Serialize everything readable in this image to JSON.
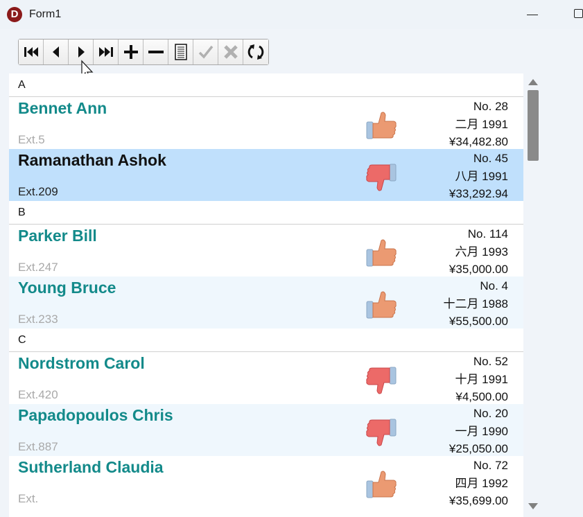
{
  "window": {
    "title": "Form1",
    "icon_letter": "D"
  },
  "navigator": {
    "buttons": [
      "first-icon",
      "prior-icon",
      "next-icon",
      "last-icon",
      "insert-icon",
      "delete-icon",
      "edit-icon",
      "post-icon",
      "cancel-icon",
      "refresh-icon"
    ]
  },
  "list": {
    "groups": [
      {
        "header": "A",
        "items": [
          {
            "name": "Bennet Ann",
            "ext": "Ext.5",
            "number": "No. 28",
            "date": "二月 1991",
            "amount": "¥34,482.80",
            "rating": "thumbs-up"
          },
          {
            "name": "Ramanathan Ashok",
            "ext": "Ext.209",
            "number": "No. 45",
            "date": "八月 1991",
            "amount": "¥33,292.94",
            "rating": "thumbs-down",
            "selected": true
          }
        ]
      },
      {
        "header": "B",
        "items": [
          {
            "name": "Parker Bill",
            "ext": "Ext.247",
            "number": "No. 114",
            "date": "六月 1993",
            "amount": "¥35,000.00",
            "rating": "thumbs-up"
          },
          {
            "name": "Young Bruce",
            "ext": "Ext.233",
            "number": "No. 4",
            "date": "十二月 1988",
            "amount": "¥55,500.00",
            "rating": "thumbs-up"
          }
        ]
      },
      {
        "header": "C",
        "items": [
          {
            "name": "Nordstrom Carol",
            "ext": "Ext.420",
            "number": "No. 52",
            "date": "十月 1991",
            "amount": "¥4,500.00",
            "rating": "thumbs-down"
          },
          {
            "name": "Papadopoulos Chris",
            "ext": "Ext.887",
            "number": "No. 20",
            "date": "一月 1990",
            "amount": "¥25,050.00",
            "rating": "thumbs-down"
          },
          {
            "name": "Sutherland Claudia",
            "ext": "Ext.",
            "number": "No. 72",
            "date": "四月 1992",
            "amount": "¥35,699.00",
            "rating": "thumbs-up"
          }
        ]
      }
    ]
  },
  "colors": {
    "name_teal": "#138a8a",
    "selected_bg": "#c0e0fc",
    "alt_row_bg": "#eff7fd"
  }
}
